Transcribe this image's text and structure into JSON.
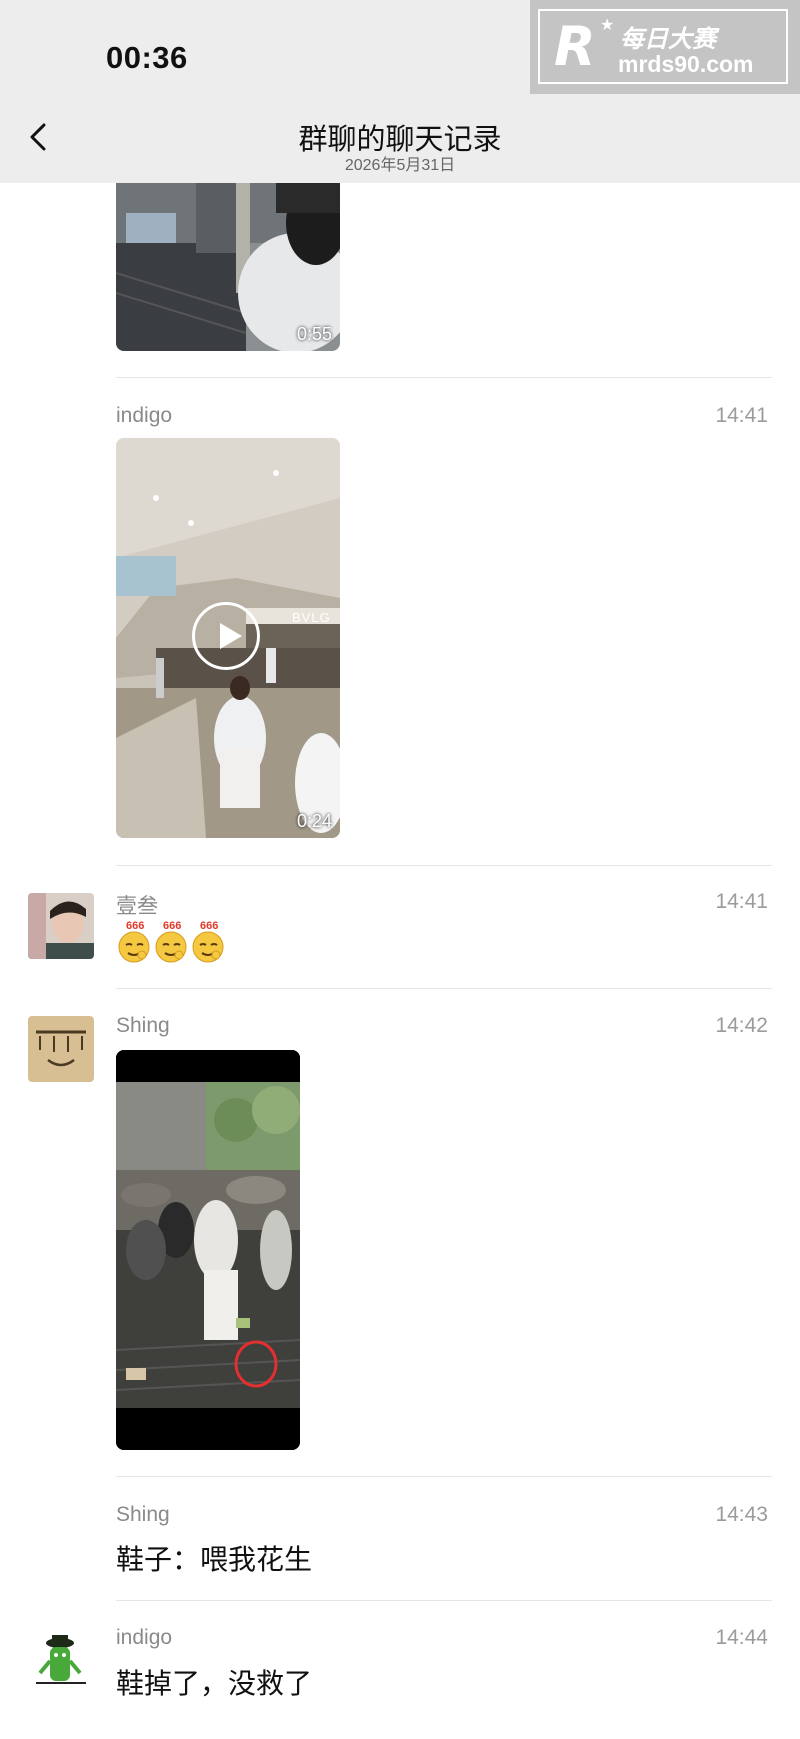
{
  "status_bar": {
    "time": "00:36"
  },
  "watermark": {
    "logo": "R",
    "name": "每日大赛",
    "url": "mrds90.com"
  },
  "header": {
    "title": "群聊的聊天记录",
    "date": "2026年5月31日"
  },
  "messages": [
    {
      "duration": "0:55"
    },
    {
      "sender": "indigo",
      "time": "14:41",
      "duration": "0:24",
      "sign_text": "BVLG"
    },
    {
      "sender": "壹叁",
      "time": "14:41",
      "emoji_count": 3,
      "emoji_label": "666"
    },
    {
      "sender": "Shing",
      "time": "14:42"
    },
    {
      "sender": "Shing",
      "time": "14:43",
      "text": "鞋子：喂我花生"
    },
    {
      "sender": "indigo",
      "time": "14:44",
      "text": "鞋掉了，没救了"
    }
  ],
  "colors": {
    "header_bg": "#ededed",
    "divider": "#e6e6e6",
    "name_text": "#8a8a8a"
  }
}
